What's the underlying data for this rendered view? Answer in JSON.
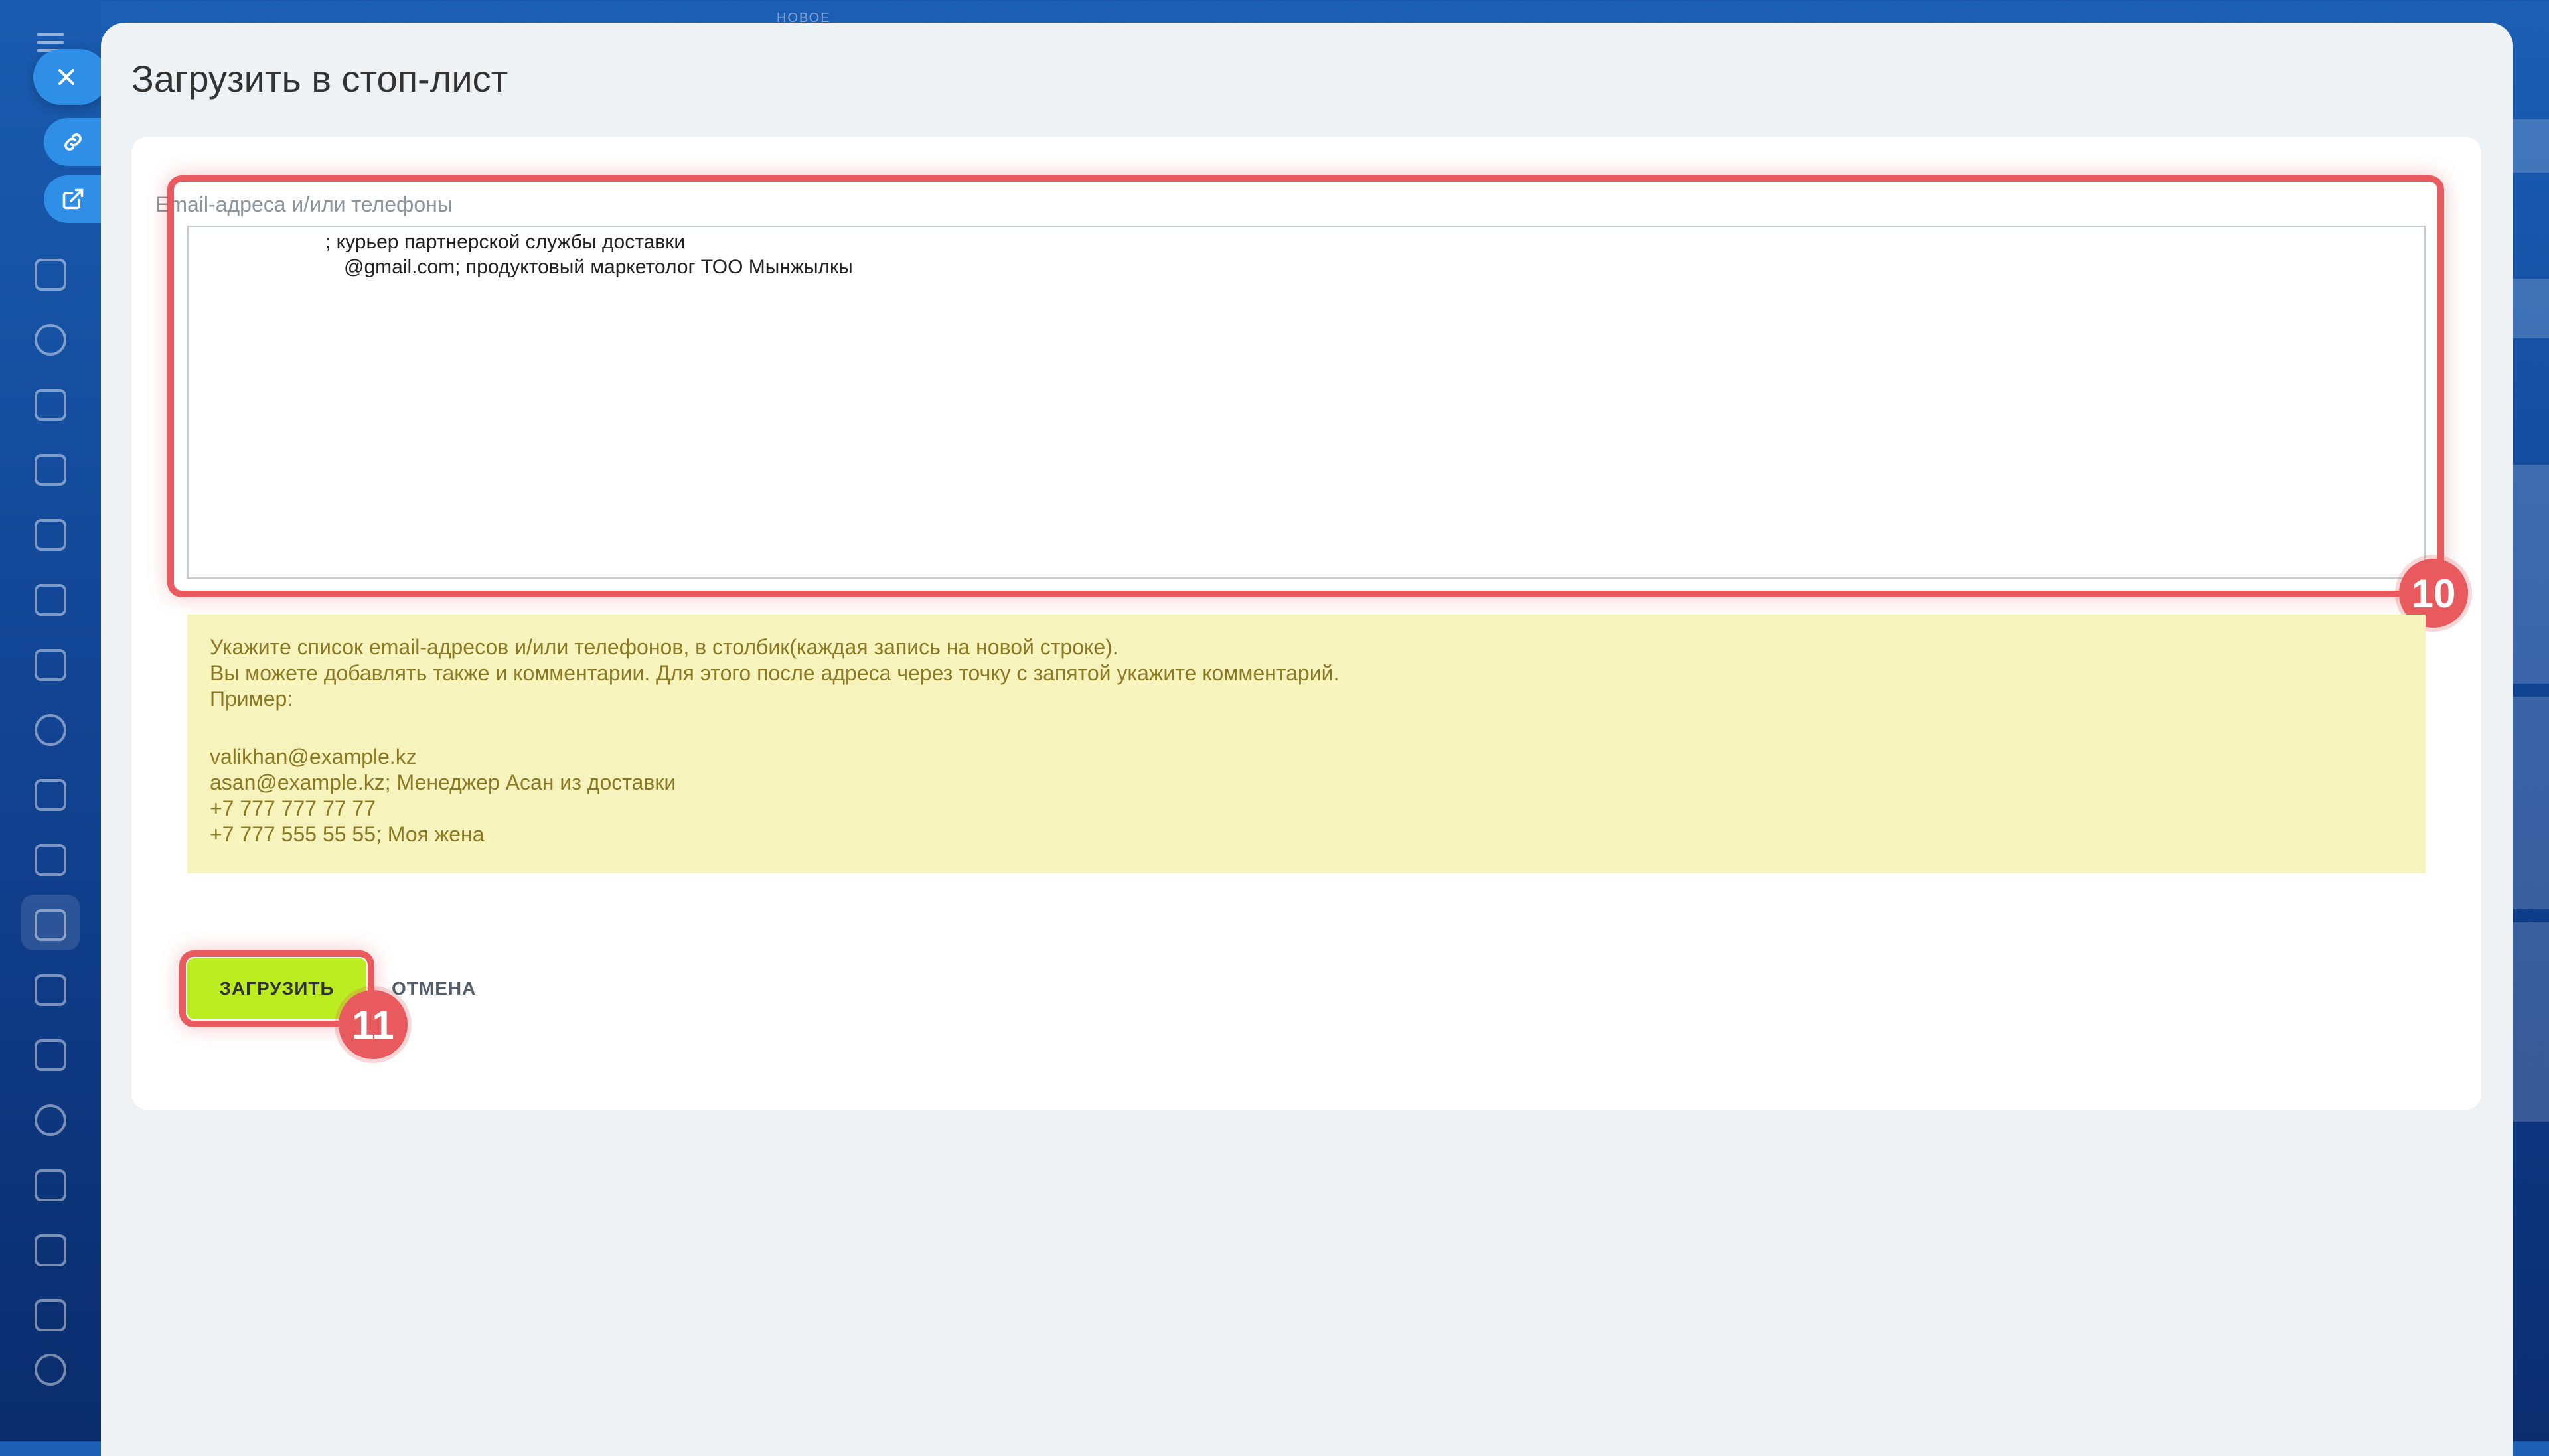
{
  "background": {
    "top_label": "НОВОЕ",
    "sidebar_icons": [
      "menu-icon",
      "close-icon",
      "link-icon",
      "external-link-icon",
      "news-icon",
      "hexagon-icon",
      "calendar-icon",
      "document-icon",
      "presentation-icon",
      "inbox-icon",
      "mail-icon",
      "contacts-icon",
      "sales-icon",
      "tasks-icon",
      "filter-icon",
      "planner-icon",
      "store-icon",
      "target-icon",
      "cart-icon",
      "edit-doc-icon",
      "pen-icon",
      "settings-icon"
    ]
  },
  "panel": {
    "title": "Загрузить в стоп-лист"
  },
  "form": {
    "field_label": "Email-адреса и/или телефоны",
    "textarea_lines": [
      "; курьер партнерской службы доставки",
      "@gmail.com; продуктовый маркетолог ТОО Мынжылкы"
    ]
  },
  "hint": {
    "lines": [
      "Укажите список email-адресов и/или телефонов, в столбик(каждая запись на новой строке).",
      "Вы можете добавлять также и комментарии. Для этого после адреса через точку с запятой укажите комментарий.",
      "Пример:"
    ],
    "examples": [
      "valikhan@example.kz",
      "asan@example.kz; Менеджер Асан из доставки",
      "+7 777 777 77 77",
      "+7 777 555 55 55; Моя жена"
    ]
  },
  "buttons": {
    "load": "ЗАГРУЗИТЬ",
    "cancel": "ОТМЕНА"
  },
  "annotations": {
    "badge_textarea": "10",
    "badge_button": "11"
  },
  "colors": {
    "highlight": "#e85a5e",
    "load_button": "#bbed21",
    "hint_bg": "#f7f3bc",
    "hint_text": "#8b7a24",
    "panel_bg": "#eef2f4"
  }
}
